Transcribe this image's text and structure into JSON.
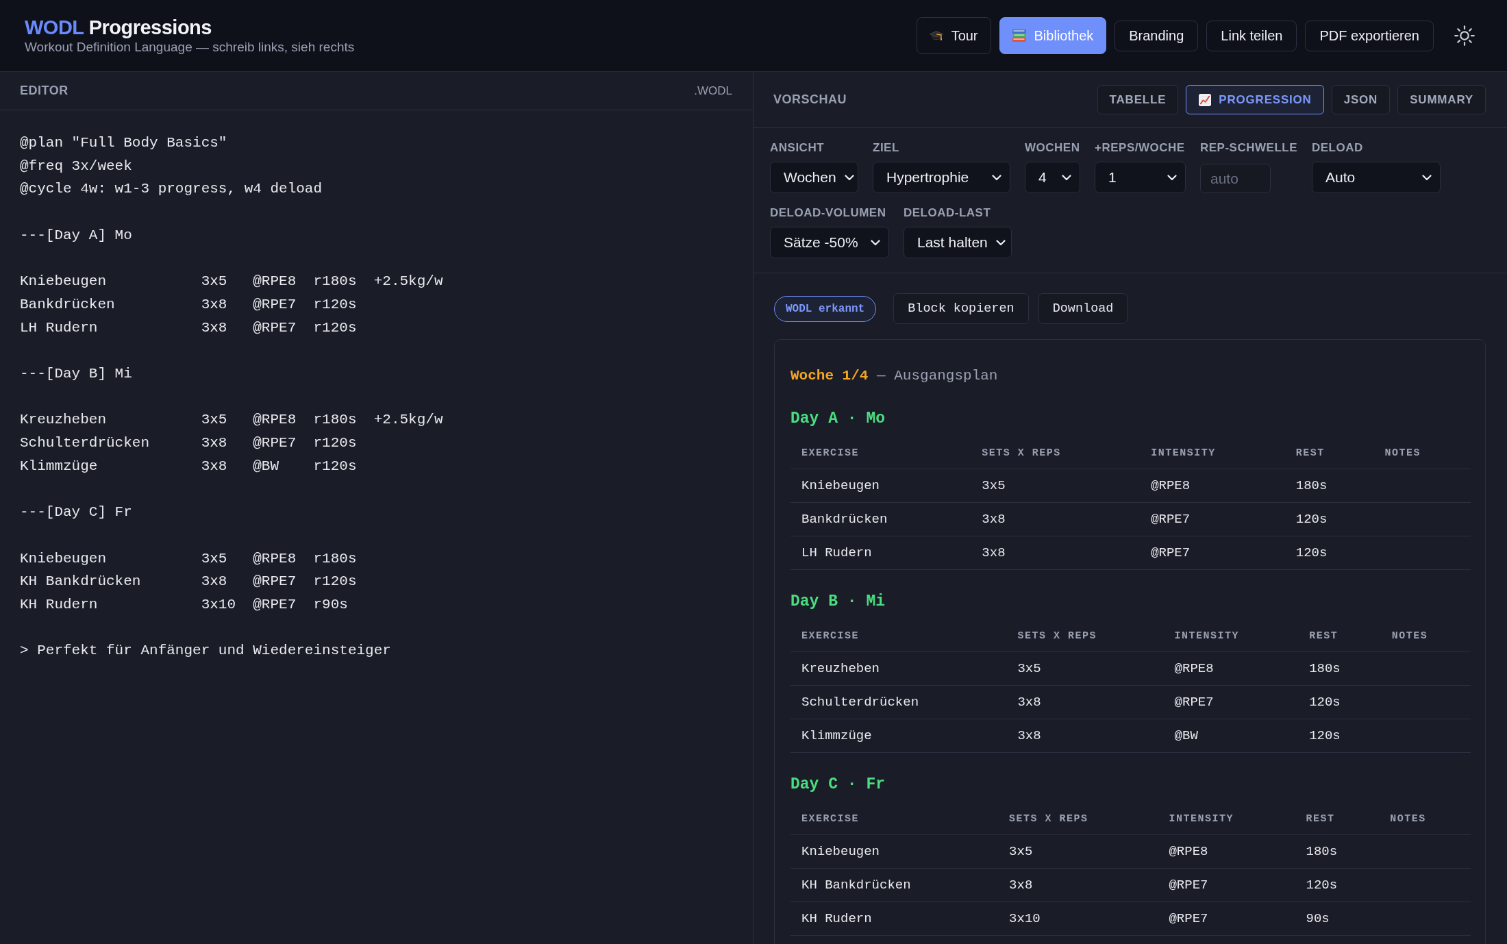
{
  "header": {
    "title_accent": "WODL",
    "title": "Progressions",
    "subtitle": "Workout Definition Language — schreib links, sieh rechts",
    "tour_button": {
      "label": "Tour"
    },
    "library_button": {
      "label": "Bibliothek"
    },
    "buttons": [
      "Branding",
      "Link teilen",
      "PDF exportieren"
    ]
  },
  "editor": {
    "title": "EDITOR",
    "extension": ".WODL",
    "code": "@plan \"Full Body Basics\"\n@freq 3x/week\n@cycle 4w: w1-3 progress, w4 deload\n\n---[Day A] Mo\n\nKniebeugen           3x5   @RPE8  r180s  +2.5kg/w\nBankdrücken          3x8   @RPE7  r120s\nLH Rudern            3x8   @RPE7  r120s\n\n---[Day B] Mi\n\nKreuzheben           3x5   @RPE8  r180s  +2.5kg/w\nSchulterdrücken      3x8   @RPE7  r120s\nKlimmzüge            3x8   @BW    r120s\n\n---[Day C] Fr\n\nKniebeugen           3x5   @RPE8  r180s\nKH Bankdrücken       3x8   @RPE7  r120s\nKH Rudern            3x10  @RPE7  r90s\n\n> Perfekt für Anfänger und Wiedereinsteiger"
  },
  "preview": {
    "title": "VORSCHAU",
    "tabs": [
      {
        "label": "TABELLE",
        "kind": "text",
        "selected": false
      },
      {
        "label": "PROGRESSION",
        "kind": "icon",
        "selected": true
      },
      {
        "label": "JSON",
        "kind": "text",
        "selected": false
      },
      {
        "label": "SUMMARY",
        "kind": "text",
        "selected": false
      }
    ],
    "control_rows": [
      [
        {
          "kind": "select",
          "label": "ANSICHT",
          "value": "Wochen"
        },
        {
          "kind": "select",
          "label": "ZIEL",
          "value": "Hypertrophie"
        },
        {
          "kind": "select",
          "label": "WOCHEN",
          "value": "4"
        },
        {
          "kind": "select",
          "label": "+REPS/WOCHE",
          "value": "1"
        },
        {
          "kind": "input",
          "label": "REP-SCHWELLE",
          "placeholder": "auto"
        },
        {
          "kind": "select",
          "label": "DELOAD",
          "value": "Auto"
        }
      ],
      [
        {
          "kind": "select",
          "label": "DELOAD-VOLUMEN",
          "value": "Sätze -50%"
        },
        {
          "kind": "select",
          "label": "DELOAD-LAST",
          "value": "Last halten"
        }
      ]
    ],
    "status_badge": "WODL erkannt",
    "actions": [
      "Block kopieren",
      "Download"
    ],
    "week": {
      "title": "Woche 1/4",
      "subtitle": "— Ausgangsplan"
    },
    "days": [
      {
        "title": "Day A · Mo",
        "columns": [
          "EXERCISE",
          "SETS X REPS",
          "INTENSITY",
          "REST",
          "NOTES"
        ],
        "rows": [
          [
            "Kniebeugen",
            "3x5",
            "@RPE8",
            "180s"
          ],
          [
            "Bankdrücken",
            "3x8",
            "@RPE7",
            "120s"
          ],
          [
            "LH Rudern",
            "3x8",
            "@RPE7",
            "120s"
          ]
        ]
      },
      {
        "title": "Day B · Mi",
        "columns": [
          "EXERCISE",
          "SETS X REPS",
          "INTENSITY",
          "REST",
          "NOTES"
        ],
        "rows": [
          [
            "Kreuzheben",
            "3x5",
            "@RPE8",
            "180s"
          ],
          [
            "Schulterdrücken",
            "3x8",
            "@RPE7",
            "120s"
          ],
          [
            "Klimmzüge",
            "3x8",
            "@BW",
            "120s"
          ]
        ]
      },
      {
        "title": "Day C · Fr",
        "columns": [
          "EXERCISE",
          "SETS X REPS",
          "INTENSITY",
          "REST",
          "NOTES"
        ],
        "rows": [
          [
            "Kniebeugen",
            "3x5",
            "@RPE8",
            "180s"
          ],
          [
            "KH Bankdrücken",
            "3x8",
            "@RPE7",
            "120s"
          ],
          [
            "KH Rudern",
            "3x10",
            "@RPE7",
            "90s"
          ]
        ]
      }
    ]
  }
}
